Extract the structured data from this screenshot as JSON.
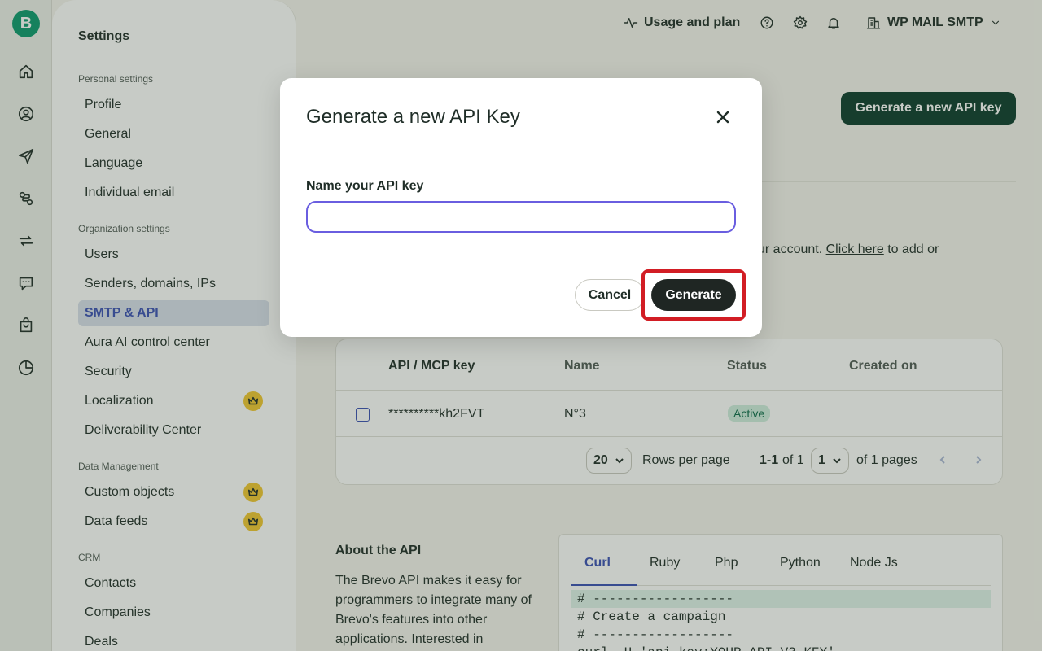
{
  "rail": {
    "logo": "B",
    "icons": [
      "home-icon",
      "contacts-icon",
      "campaigns-icon",
      "automations-icon",
      "transactional-icon",
      "conversations-icon",
      "ecommerce-icon",
      "reports-icon"
    ]
  },
  "sidebar": {
    "title": "Settings",
    "personal_label": "Personal settings",
    "personal_items": [
      "Profile",
      "General",
      "Language",
      "Individual email"
    ],
    "org_label": "Organization settings",
    "org_items": [
      "Users",
      "Senders, domains, IPs",
      "SMTP & API",
      "Aura AI control center",
      "Security",
      "Localization",
      "Deliverability Center"
    ],
    "data_label": "Data Management",
    "data_items": [
      "Custom objects",
      "Data feeds"
    ],
    "crm_label": "CRM",
    "crm_items": [
      "Contacts",
      "Companies",
      "Deals"
    ]
  },
  "header": {
    "usage": "Usage and plan",
    "account": "WP MAIL SMTP"
  },
  "page": {
    "generate_button": "Generate a new API key",
    "info_prefix": "ur account. ",
    "info_link": "Click here",
    "info_suffix": " to add or"
  },
  "table": {
    "columns": [
      "API / MCP key",
      "Name",
      "Status",
      "Created on"
    ],
    "rows": [
      {
        "key": "**********kh2FVT",
        "name": "N°3",
        "status": "Active",
        "created": ""
      }
    ],
    "rows_per_page": "20",
    "rows_per_page_label": "Rows per page",
    "range": "1-1",
    "of_total": "of 1",
    "page": "1",
    "of_pages": "of 1 pages"
  },
  "about": {
    "title": "About the API",
    "text": "The Brevo API makes it easy for programmers to integrate many of Brevo's features into other applications. Interested in"
  },
  "code": {
    "tabs": [
      "Curl",
      "Ruby",
      "Php",
      "Python",
      "Node Js"
    ],
    "lines": [
      "# ------------------",
      "# Create a campaign",
      "# ------------------",
      "curl -H 'api-key:YOUR_API_V3_KEY'"
    ]
  },
  "modal": {
    "title": "Generate a new API Key",
    "field_label": "Name your API key",
    "field_value": "",
    "cancel": "Cancel",
    "generate": "Generate",
    "highlight_color": "#d21d24"
  }
}
